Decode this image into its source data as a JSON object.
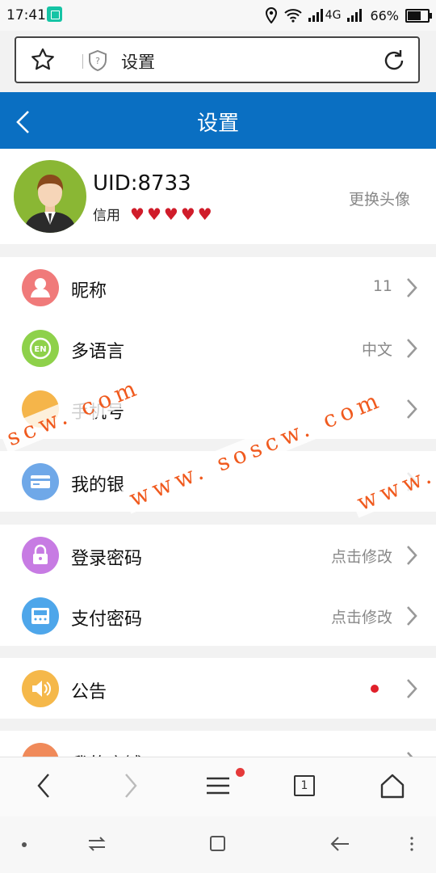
{
  "status_bar": {
    "time": "17:41",
    "network": "4G",
    "battery": "66%",
    "icons": [
      "scan-icon",
      "location-icon",
      "wifi-icon",
      "signal-icon",
      "signal-icon",
      "battery-icon"
    ]
  },
  "browser_bar": {
    "url_text": "设置",
    "icons": [
      "star-icon",
      "shield-question-icon",
      "reload-icon"
    ]
  },
  "header": {
    "title": "设置"
  },
  "profile": {
    "uid": "UID:8733",
    "credit_label": "信用",
    "credit_hearts": 5,
    "change_avatar": "更换头像"
  },
  "groups": [
    {
      "items": [
        {
          "label": "昵称",
          "value": "11",
          "icon": "user-icon",
          "color": "#f07a7a"
        },
        {
          "label": "多语言",
          "value": "中文",
          "icon": "language-en-icon",
          "color": "#8ed14a"
        },
        {
          "label": "手机号",
          "value": "",
          "icon": "phone-icon",
          "color": "#f5b54a"
        }
      ]
    },
    {
      "items": [
        {
          "label": "我的银",
          "value": "",
          "icon": "card-icon",
          "color": "#6fa8e8"
        }
      ]
    },
    {
      "items": [
        {
          "label": "登录密码",
          "value": "点击修改",
          "icon": "lock-icon",
          "color": "#c77be3"
        },
        {
          "label": "支付密码",
          "value": "点击修改",
          "icon": "keypad-icon",
          "color": "#4ea6ea"
        }
      ]
    },
    {
      "items": [
        {
          "label": "公告",
          "value": "",
          "icon": "speaker-icon",
          "color": "#f5b84a",
          "dot": true
        }
      ]
    },
    {
      "items": [
        {
          "label": "我的店铺",
          "value": "",
          "icon": "store-icon",
          "color": "#f08a5a"
        }
      ]
    }
  ],
  "watermarks": [
    "scw. com",
    "www. soscw. com",
    "www. sos"
  ],
  "browser_nav": {
    "tabs_count": "1",
    "icons": [
      "back-icon",
      "forward-icon",
      "menu-icon",
      "tabs-icon",
      "home-icon"
    ]
  },
  "system_nav": {
    "icons": [
      "dot-icon",
      "switch-icon",
      "recent-apps-icon",
      "back-arrow-icon",
      "more-icon"
    ]
  }
}
